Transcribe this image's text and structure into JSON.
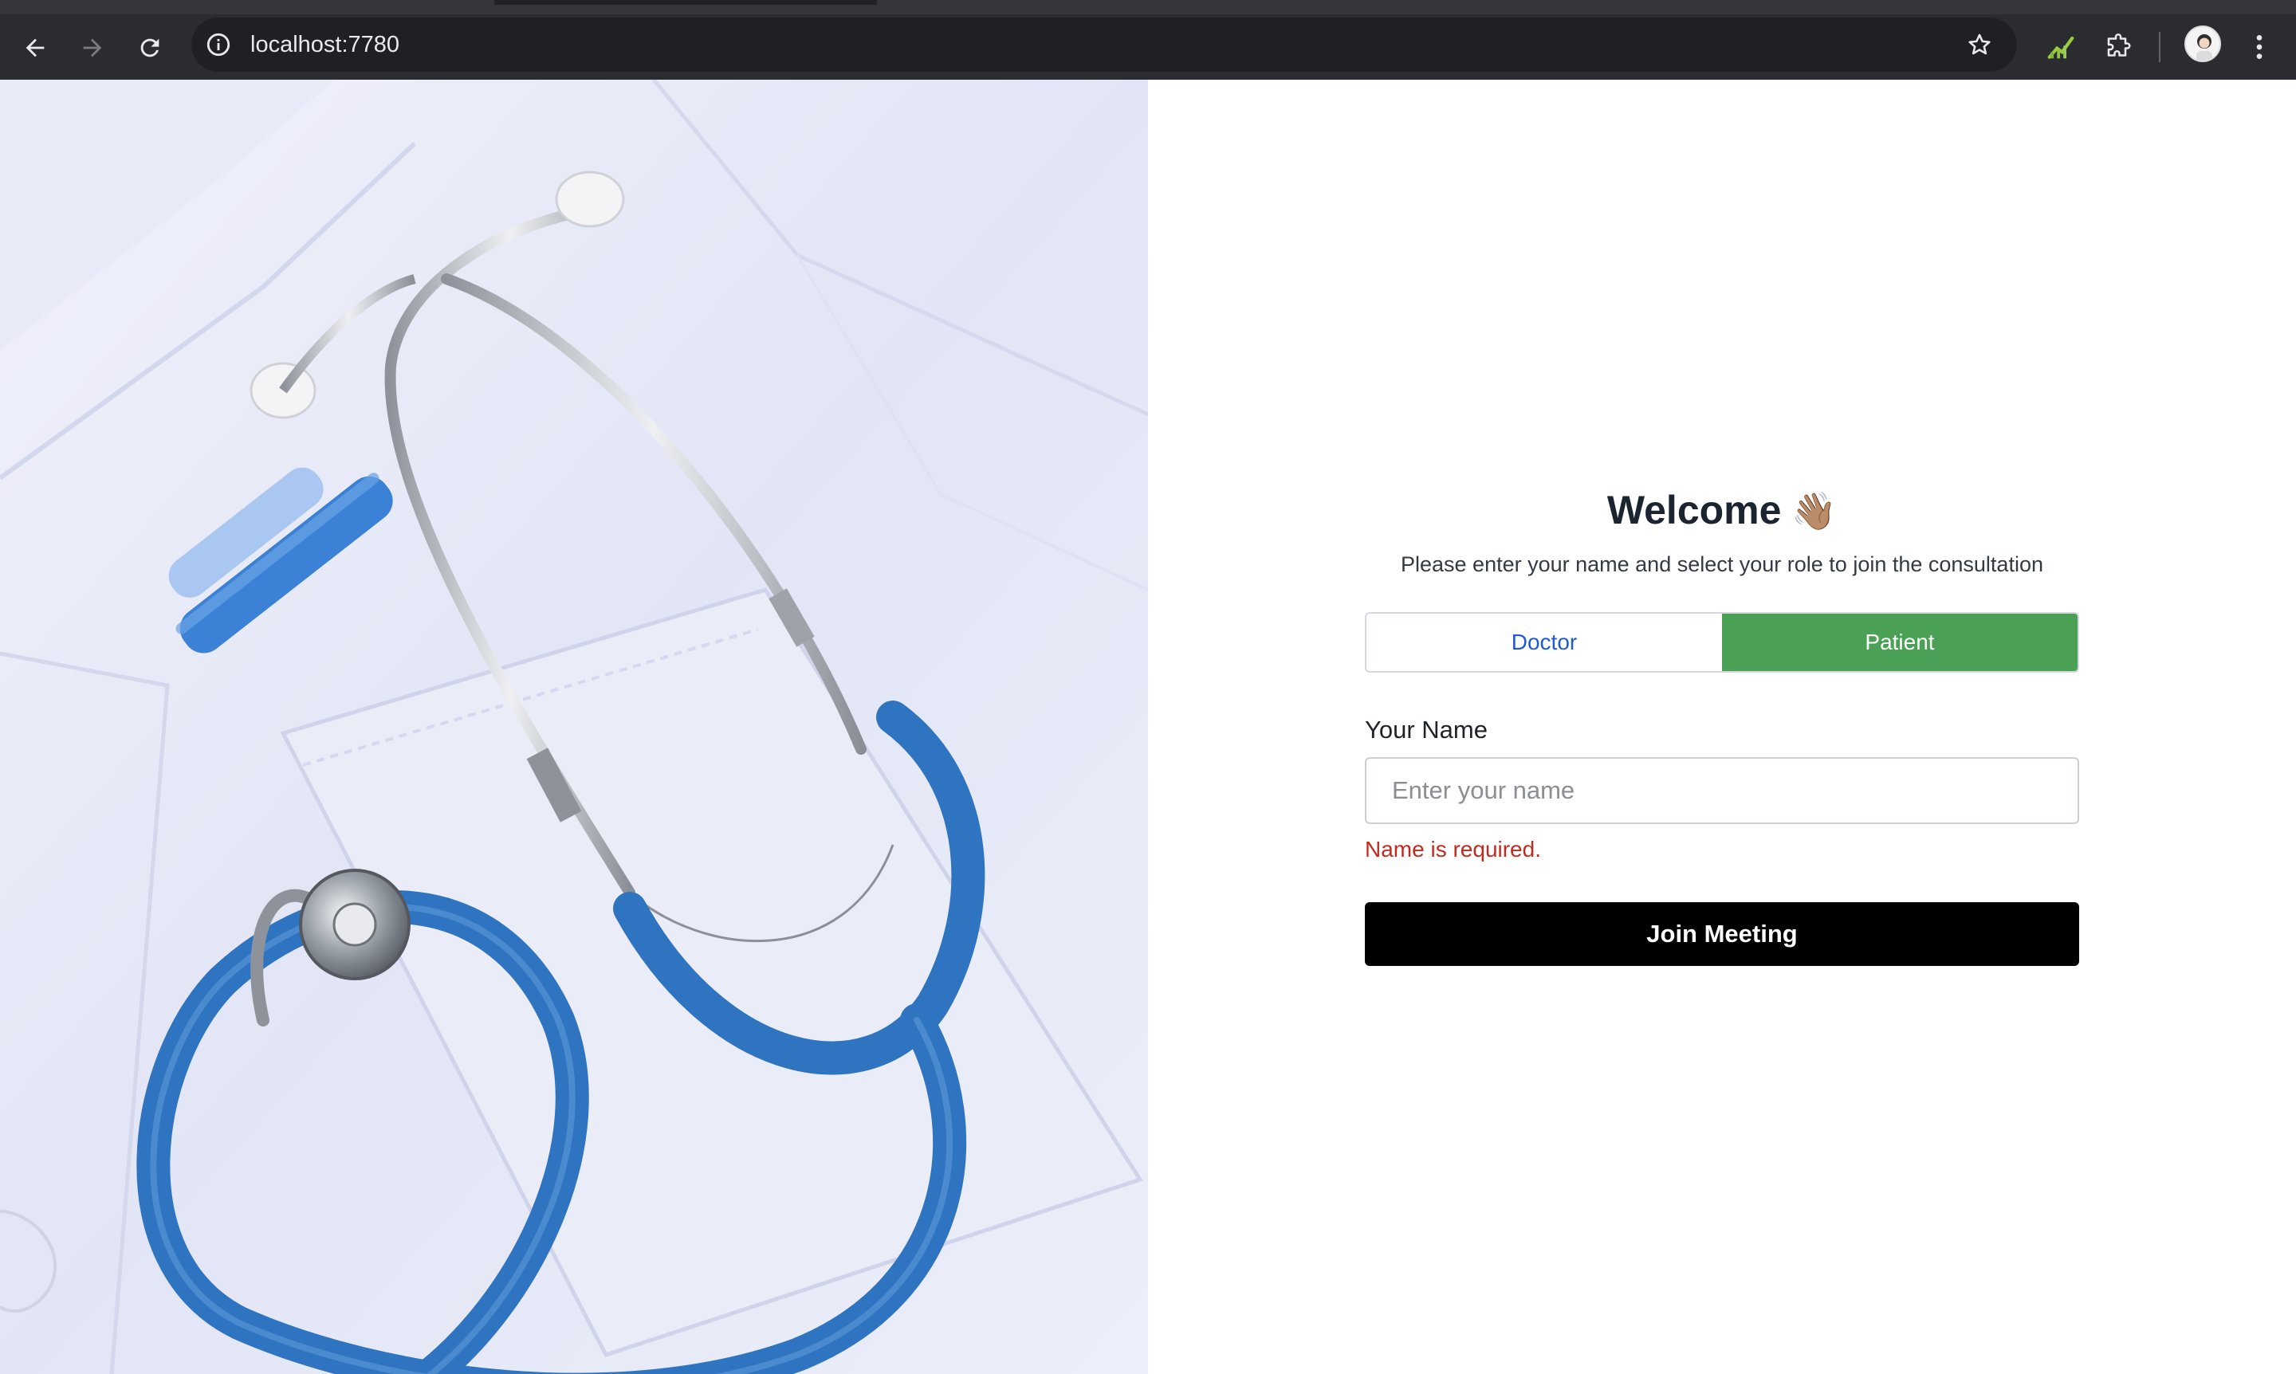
{
  "browser": {
    "url": "localhost:7780",
    "icons": {
      "back": "arrow-left-icon",
      "forward": "arrow-right-icon",
      "reload": "reload-icon",
      "site_info": "info-icon",
      "bookmark": "star-icon",
      "extension_perf": "performance-extension-icon",
      "extensions": "puzzle-icon",
      "profile": "avatar",
      "menu": "kebab-menu-icon"
    }
  },
  "hero": {
    "image_subject": "stethoscope-on-white-coat"
  },
  "form": {
    "title": "Welcome",
    "title_emoji": "👋🏽",
    "subtitle": "Please enter your name and select your role to join the consultation",
    "roles": {
      "doctor": "Doctor",
      "patient": "Patient",
      "selected": "Patient"
    },
    "name_label": "Your Name",
    "name_value": "",
    "name_placeholder": "Enter your name",
    "error": "Name is required.",
    "submit_label": "Join Meeting"
  },
  "colors": {
    "selected_role": "#4aa054",
    "unselected_role_text": "#1f5bd0",
    "error_text": "#c22b20",
    "submit_bg": "#000000",
    "stethoscope_tube": "#2f74c0"
  }
}
